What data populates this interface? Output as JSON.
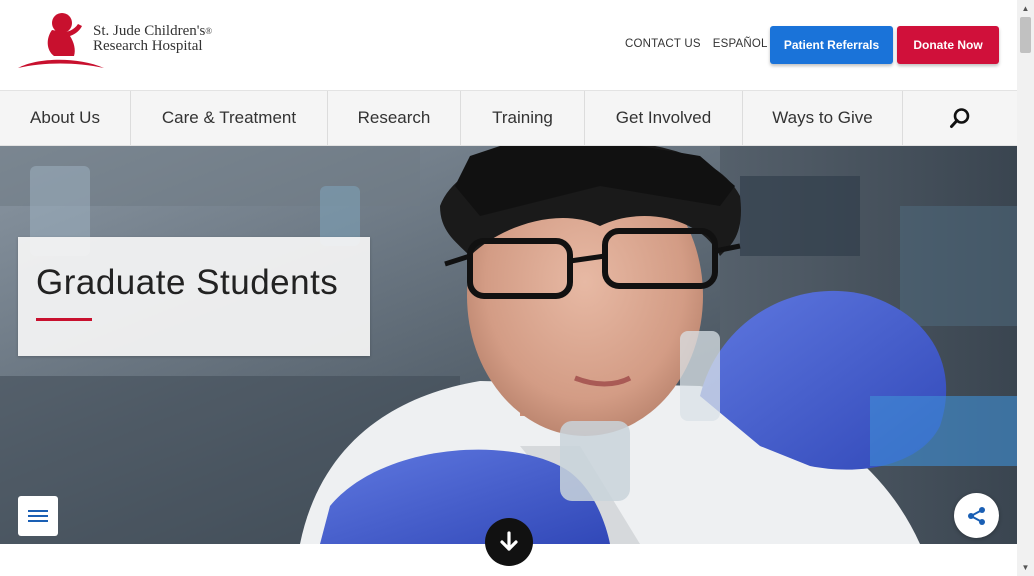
{
  "header": {
    "logo_line1": "St. Jude Children's",
    "logo_line2": "Research Hospital",
    "logo_reg": "®",
    "util_links": [
      "CONTACT US",
      "ESPAÑOL"
    ],
    "referrals_label": "Patient Referrals",
    "donate_label": "Donate Now"
  },
  "nav": {
    "items": [
      "About Us",
      "Care & Treatment",
      "Research",
      "Training",
      "Get Involved",
      "Ways to Give"
    ],
    "search_icon": "search-icon"
  },
  "hero": {
    "title": "Graduate Students",
    "menu_icon": "hamburger-menu-icon",
    "share_icon": "share-icon",
    "scroll_icon": "arrow-down-icon"
  },
  "colors": {
    "brand_red": "#c8102e",
    "donate_red": "#d0103a",
    "referral_blue": "#1a73d9",
    "nav_bg": "#f5f5f5"
  }
}
